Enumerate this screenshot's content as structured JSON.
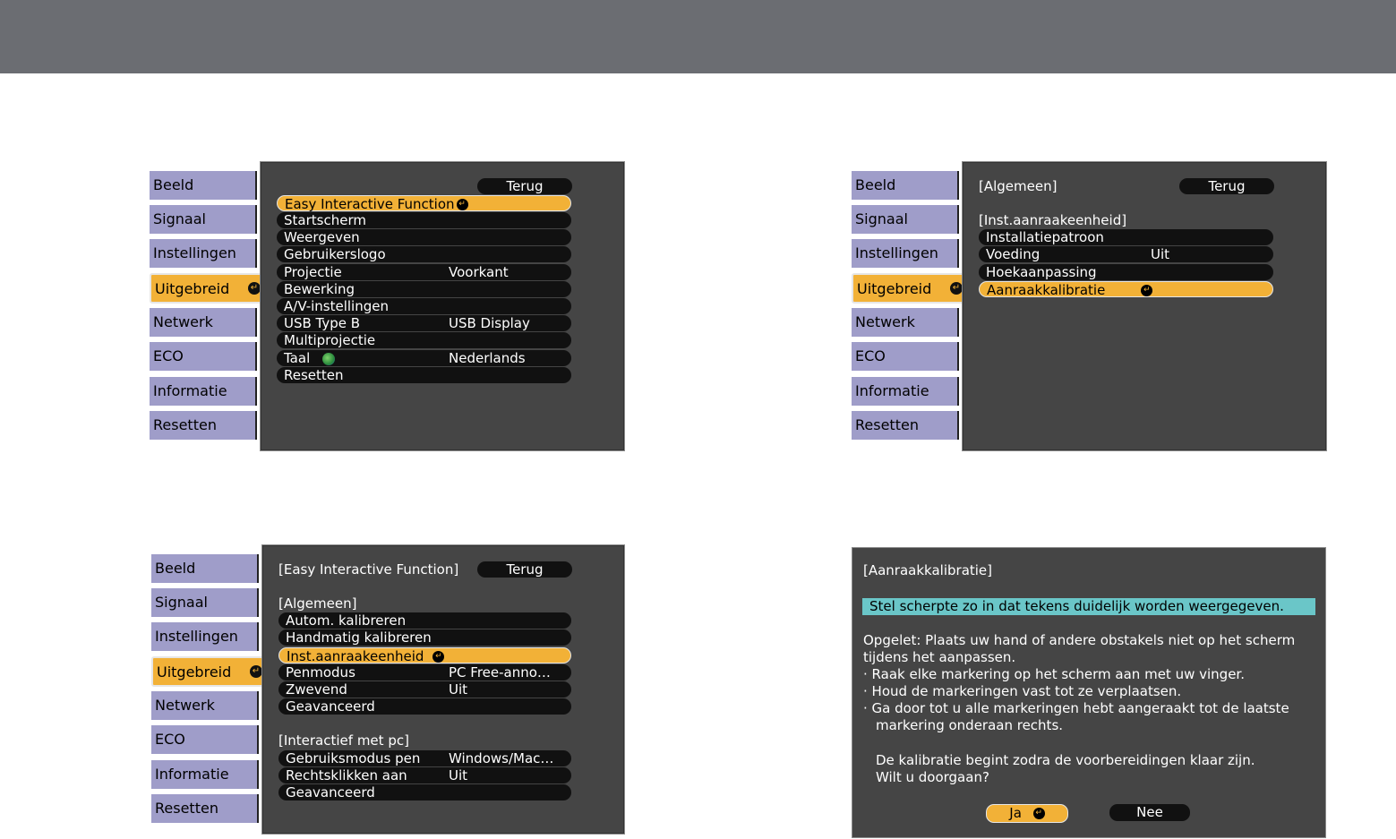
{
  "tabs": [
    "Beeld",
    "Signaal",
    "Instellingen",
    "Uitgebreid",
    "Netwerk",
    "ECO",
    "Informatie",
    "Resetten"
  ],
  "active_tab": "Uitgebreid",
  "back_label": "Terug",
  "panel1": {
    "items": [
      {
        "label": "Easy Interactive Function",
        "value": ""
      },
      {
        "label": "Startscherm",
        "value": ""
      },
      {
        "label": "Weergeven",
        "value": ""
      },
      {
        "label": "Gebruikerslogo",
        "value": ""
      },
      {
        "label": "Projectie",
        "value": "Voorkant"
      },
      {
        "label": "Bewerking",
        "value": ""
      },
      {
        "label": "A/V-instellingen",
        "value": ""
      },
      {
        "label": "USB Type B",
        "value": "USB Display"
      },
      {
        "label": "Multiprojectie",
        "value": ""
      },
      {
        "label": "Taal",
        "value": "Nederlands"
      },
      {
        "label": "Resetten",
        "value": ""
      }
    ]
  },
  "panel2": {
    "heading1": "[Algemeen]",
    "heading2": "[Inst.aanraakeenheid]",
    "items": [
      {
        "label": "Installatiepatroon",
        "value": ""
      },
      {
        "label": "Voeding",
        "value": "Uit"
      },
      {
        "label": "Hoekaanpassing",
        "value": ""
      },
      {
        "label": "Aanraakkalibratie",
        "value": ""
      }
    ]
  },
  "panel3": {
    "heading1": "[Easy Interactive Function]",
    "heading2": "[Algemeen]",
    "items_a": [
      {
        "label": "Autom. kalibreren",
        "value": ""
      },
      {
        "label": "Handmatig kalibreren",
        "value": ""
      },
      {
        "label": "Inst.aanraakeenheid",
        "value": ""
      },
      {
        "label": "Penmodus",
        "value": "PC Free-anno…"
      },
      {
        "label": "Zwevend",
        "value": "Uit"
      },
      {
        "label": "Geavanceerd",
        "value": ""
      }
    ],
    "heading3": "[Interactief met pc]",
    "items_b": [
      {
        "label": "Gebruiksmodus pen",
        "value": "Windows/Mac…"
      },
      {
        "label": "Rechtsklikken aan",
        "value": "Uit"
      },
      {
        "label": "Geavanceerd",
        "value": ""
      }
    ]
  },
  "dialog": {
    "title": "[Aanraakkalibratie]",
    "highlight": "Stel scherpte zo in dat tekens duidelijk worden weergegeven.",
    "line1": "Opgelet: Plaats uw hand of andere obstakels niet op het scherm",
    "line2": "tijdens het aanpassen.",
    "bullet1": "·  Raak elke markering op het scherm aan met uw vinger.",
    "bullet2": "·  Houd de markeringen vast tot ze verplaatsen.",
    "bullet3": "·  Ga door tot u alle markeringen hebt aangeraakt tot de laatste",
    "bullet3b": "markering onderaan rechts.",
    "info1": "De kalibratie begint zodra de voorbereidingen klaar zijn.",
    "info2": "Wilt u doorgaan?",
    "yes_label": "Ja",
    "no_label": "Nee"
  }
}
